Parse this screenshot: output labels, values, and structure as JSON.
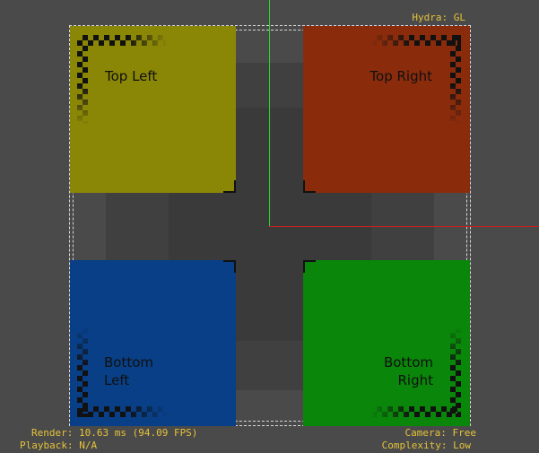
{
  "viewport": {
    "colors": {
      "background": "#4a4a4a",
      "top_left": "#8a8606",
      "top_right": "#8a2c0c",
      "bottom_left": "#083f86",
      "bottom_right": "#0a860a",
      "axis_y": "#2fd12f",
      "axis_x": "#c42222",
      "hud_text": "#e6c23a"
    },
    "tiles": {
      "top_left": {
        "label": "Top Left"
      },
      "top_right": {
        "label": "Top Right"
      },
      "bottom_left": {
        "line1": "Bottom",
        "line2": "Left"
      },
      "bottom_right": {
        "line1": "Bottom",
        "line2": "Right"
      }
    }
  },
  "hud": {
    "renderer": "Hydra: GL",
    "render_stats": "Render: 10.63 ms (94.09 FPS)",
    "playback": "Playback: N/A",
    "camera": "Camera: Free",
    "complexity": "Complexity: Low"
  }
}
